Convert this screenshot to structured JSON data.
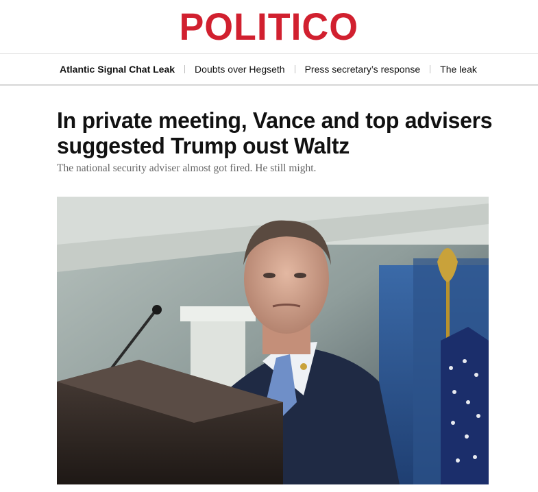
{
  "site": {
    "logo": "POLITICO"
  },
  "topics": [
    {
      "label": "Atlantic Signal Chat Leak"
    },
    {
      "label": "Doubts over Hegseth"
    },
    {
      "label": "Press secretary’s response"
    },
    {
      "label": "The leak"
    }
  ],
  "article": {
    "headline": "In private meeting, Vance and top advisers suggested Trump oust Waltz",
    "dek": "The national security adviser almost got fired. He still might."
  },
  "icons": {
    "lead_image": "press-briefing-photo"
  },
  "colors": {
    "brand_red": "#d1202f"
  }
}
